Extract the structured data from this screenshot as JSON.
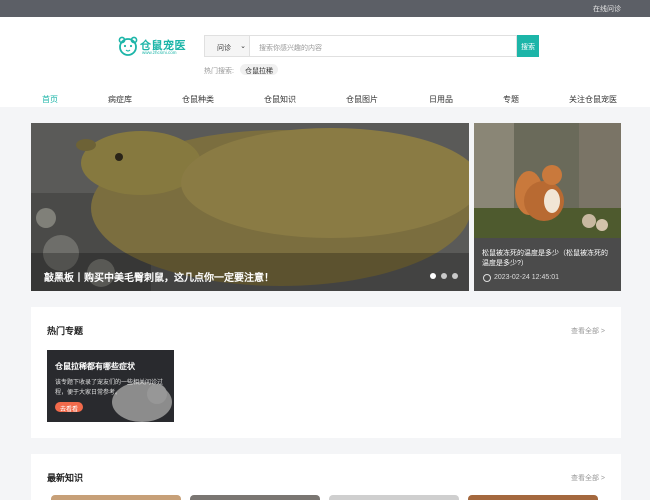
{
  "topbar": {
    "online_consult": "在线问诊"
  },
  "logo": {
    "name": "仓鼠宠医",
    "domain": "www.zhcsmi.com",
    "accent": "#1cb5a8"
  },
  "search": {
    "category": "问诊",
    "placeholder": "搜索你感兴趣的内容",
    "button": "搜索"
  },
  "hot_search": {
    "label": "热门搜索:",
    "tags": [
      "仓鼠拉稀"
    ]
  },
  "nav": {
    "items": [
      {
        "label": "首页",
        "active": true
      },
      {
        "label": "病症库"
      },
      {
        "label": "仓鼠种类"
      },
      {
        "label": "仓鼠知识"
      },
      {
        "label": "仓鼠图片"
      },
      {
        "label": "日用品"
      },
      {
        "label": "专题"
      },
      {
        "label": "关注仓鼠宠医"
      }
    ]
  },
  "banner": {
    "caption": "敲黑板丨购买中美毛臀刺鼠，这几点你一定要注意！",
    "slides": 3,
    "active_slide": 1
  },
  "side_article": {
    "title": "松鼠被冻死的温度是多少（松鼠被冻死的温度是多少?）",
    "time": "2023-02-24 12:45:01"
  },
  "topics": {
    "heading": "热门专题",
    "more": "查看全部 >",
    "items": [
      {
        "title": "仓鼠拉稀都有哪些症状",
        "desc": "该专题下收录了宠友们的一些相关问诊过程，便于大家日常参考。",
        "button": "去看看"
      }
    ]
  },
  "latest": {
    "heading": "最新知识",
    "more": "查看全部 >"
  }
}
